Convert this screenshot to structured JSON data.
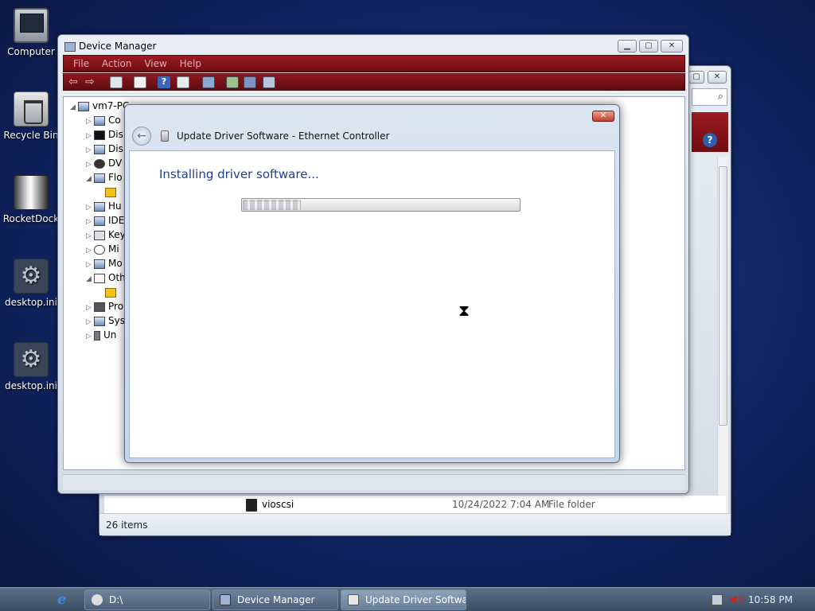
{
  "desktop": {
    "icons": [
      {
        "label": "Computer",
        "icon": "computer-icon"
      },
      {
        "label": "Recycle Bin",
        "icon": "recycle-bin-icon"
      },
      {
        "label": "RocketDock",
        "icon": "rocketdock-icon"
      },
      {
        "label": "desktop.ini",
        "icon": "gear-file-icon"
      },
      {
        "label": "desktop.ini",
        "icon": "gear-file-icon"
      }
    ]
  },
  "explorer": {
    "row": {
      "name": "vioscsi",
      "date": "10/24/2022 7:04 AM",
      "type": "File folder"
    },
    "status": "26 items"
  },
  "device_manager": {
    "title": "Device Manager",
    "menu": [
      "File",
      "Action",
      "View",
      "Help"
    ],
    "tree": {
      "root": "vm7-PC",
      "items": [
        "Co",
        "Dis",
        "Dis",
        "DV",
        "Flo",
        "",
        "Hu",
        "IDE",
        "Key",
        "Mi",
        "Mo",
        "Oth",
        "",
        "Pro",
        "Sys",
        "Un"
      ]
    }
  },
  "dialog": {
    "title": "Update Driver Software - Ethernet Controller",
    "close_label": "✕",
    "heading": "Installing driver software...",
    "progress": 0.21
  },
  "taskbar": {
    "tasks": [
      {
        "label": "D:\\"
      },
      {
        "label": "Device Manager"
      },
      {
        "label": "Update Driver Softwa..."
      }
    ],
    "clock": "10:58 PM"
  },
  "colors": {
    "menubar": "#8e1a20",
    "dialog_heading": "#1f3f8f",
    "taskbar": "#4d6078"
  }
}
